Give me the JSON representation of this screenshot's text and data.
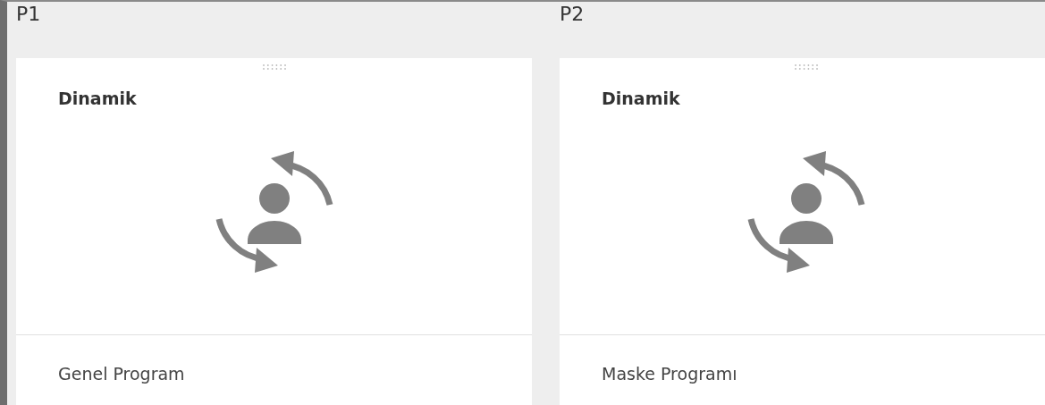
{
  "panels": [
    {
      "title": "P1",
      "card": {
        "heading": "Dinamik",
        "program": "Genel Program"
      }
    },
    {
      "title": "P2",
      "card": {
        "heading": "Dinamik",
        "program": "Maske Programı"
      }
    }
  ]
}
